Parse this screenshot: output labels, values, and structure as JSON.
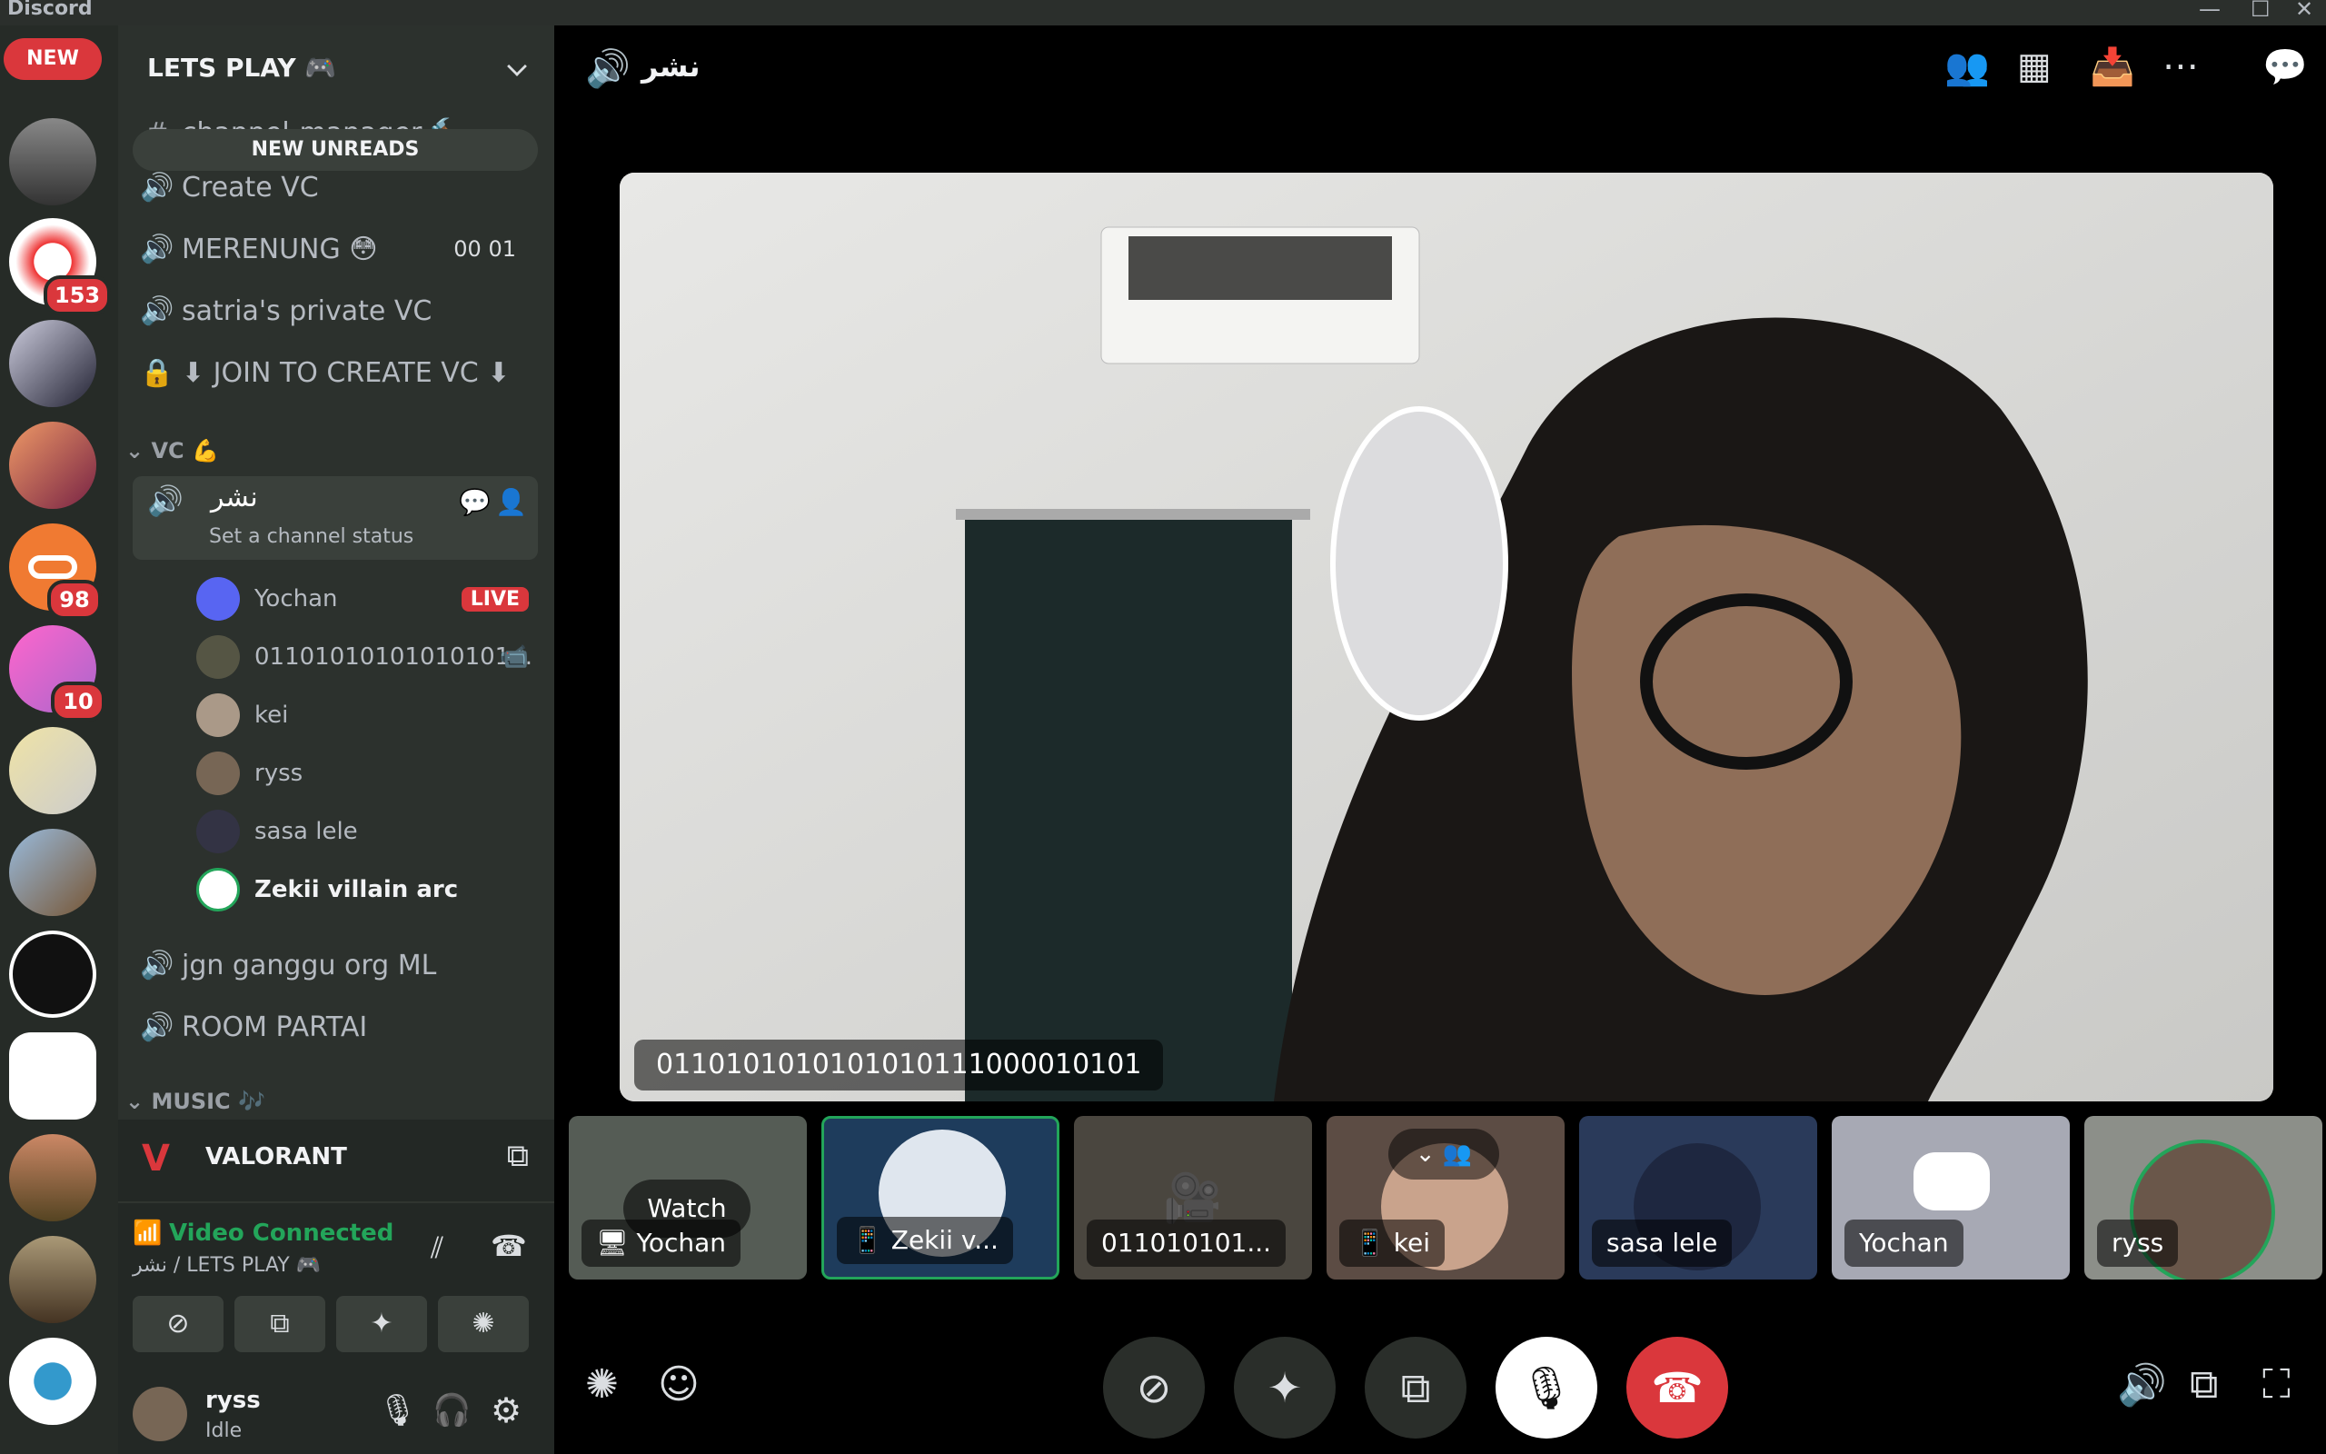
{
  "window": {
    "title": "Discord",
    "controls": [
      "—",
      "☐",
      "✕"
    ]
  },
  "rail": {
    "new_label": "NEW",
    "badges": {
      "s2": "153",
      "s5": "98",
      "s6": "10"
    }
  },
  "guild": {
    "name": "LETS PLAY 🎮"
  },
  "sidebar": {
    "new_unreads": "NEW UNREADS",
    "channels_top": [
      {
        "name": "channel-manager-🔨",
        "icon": "#"
      },
      {
        "name": "Create VC",
        "icon": "🔊"
      },
      {
        "name": "MERENUNG 😳",
        "icon": "🔊",
        "counts": "00  01"
      },
      {
        "name": "satria's private VC",
        "icon": "🔊"
      },
      {
        "name": "⬇ JOIN TO CREATE VC ⬇",
        "icon": "🔒"
      }
    ],
    "category_vc": "VC 💪",
    "active_channel": {
      "name": "نشر",
      "status": "Set a channel status"
    },
    "members": [
      {
        "name": "Yochan",
        "live": "LIVE"
      },
      {
        "name": "01101010101010101..."
      },
      {
        "name": "kei"
      },
      {
        "name": "ryss"
      },
      {
        "name": "sasa lele"
      },
      {
        "name": "Zekii villain arc"
      }
    ],
    "channels_bottom": [
      {
        "name": "jgn ganggu org ML",
        "icon": "🔊"
      },
      {
        "name": "ROOM PARTAI",
        "icon": "🔊"
      }
    ],
    "category_music": "MUSIC 🎶"
  },
  "activity": {
    "game": "VALORANT"
  },
  "voice": {
    "status": "Video Connected",
    "location": "نشر / LETS PLAY 🎮"
  },
  "user": {
    "name": "ryss",
    "status": "Idle"
  },
  "main": {
    "channel_name": "نشر",
    "stage_name": "0110101010101010111000010101",
    "tiles": [
      {
        "label": "Yochan",
        "watch": "Watch",
        "icon": "screen"
      },
      {
        "label": "Zekii v...",
        "icon": "phone"
      },
      {
        "label": "011010101..."
      },
      {
        "label": "kei",
        "icon": "phone"
      },
      {
        "label": "sasa lele"
      },
      {
        "label": "Yochan"
      },
      {
        "label": "ryss"
      }
    ]
  },
  "colors": {
    "accent_green": "#23a55a",
    "danger": "#da373c",
    "panel": "#2c312d"
  }
}
